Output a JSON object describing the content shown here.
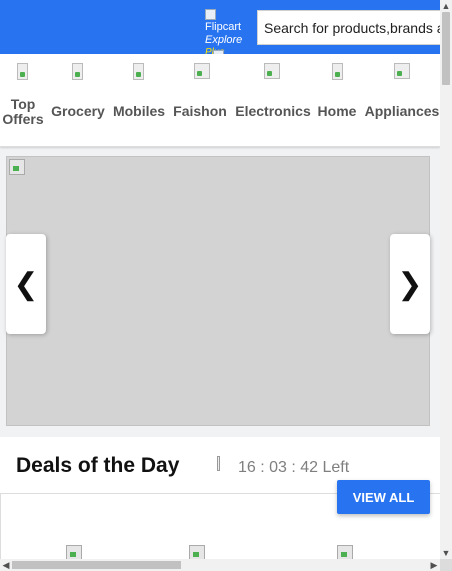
{
  "header": {
    "logo_alt": "Flipcart",
    "logo_explore": "Explore",
    "logo_plus": "Plus",
    "search_placeholder": "Search for products,brands and more"
  },
  "categories": [
    {
      "label": "Top Offers",
      "icon": "top-offers-image"
    },
    {
      "label": "Grocery",
      "icon": "grocery-image"
    },
    {
      "label": "Mobiles",
      "icon": "mobiles-image"
    },
    {
      "label": "Faishon",
      "icon": "fashion-image"
    },
    {
      "label": "Electronics",
      "icon": "electronics-image"
    },
    {
      "label": "Home",
      "icon": "home-image"
    },
    {
      "label": "Appliances",
      "icon": "appliances-image"
    }
  ],
  "banner": {
    "prev_glyph": "❮",
    "next_glyph": "❯"
  },
  "deals": {
    "title": "Deals of the Day",
    "timer": "16 : 03 : 42 Left",
    "view_all": "VIEW ALL"
  },
  "scrollbars": {
    "up": "▲",
    "down": "▼",
    "left": "◀",
    "right": "▶"
  },
  "colors": {
    "brand_blue": "#2874f0",
    "plus_yellow": "#ffe500",
    "page_bg": "#f1f2f4"
  }
}
